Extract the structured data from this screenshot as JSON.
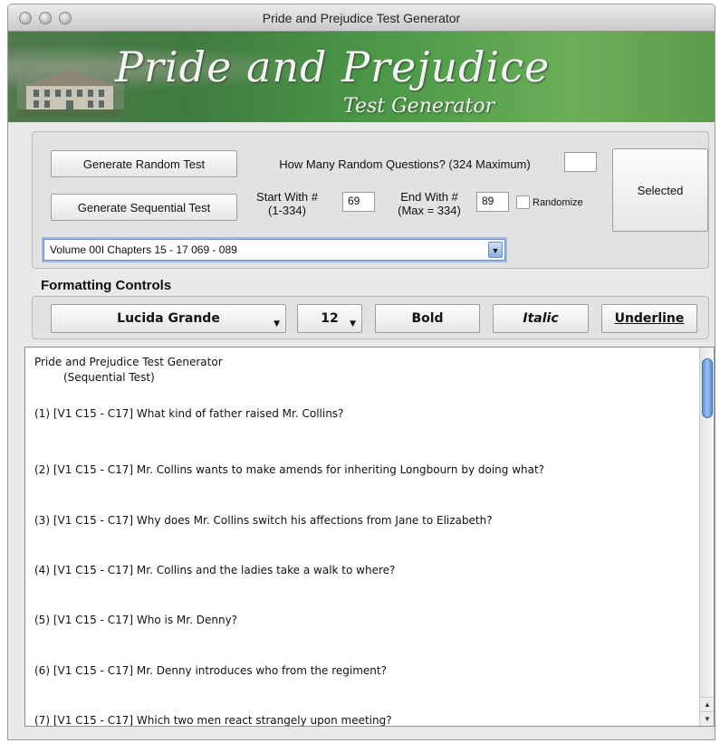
{
  "window": {
    "title": "Pride and Prejudice Test Generator"
  },
  "banner": {
    "title": "Pride and Prejudice",
    "subtitle": "Test Generator"
  },
  "generator": {
    "random_button": "Generate Random Test",
    "random_label": "How Many Random Questions? (324 Maximum)",
    "random_value": "",
    "sequential_button": "Generate Sequential Test",
    "start_label_1": "Start With #",
    "start_label_2": "(1-334)",
    "start_value": "69",
    "end_label_1": "End With #",
    "end_label_2": "(Max = 334)",
    "end_value": "89",
    "randomize_label": "Randomize",
    "selected_button": "Selected",
    "volume_select": "Volume 00I   Chapters 15 - 17  069 - 089"
  },
  "formatting": {
    "heading": "Formatting Controls",
    "font": "Lucida Grande",
    "size": "12",
    "bold": "Bold",
    "italic": "Italic",
    "underline": "Underline"
  },
  "document": {
    "title": "Pride and Prejudice Test Generator",
    "subtitle": "(Sequential Test)",
    "questions": [
      "(1)  [V1 C15 - C17] What kind of father raised Mr. Collins?",
      "(2)  [V1 C15 - C17] Mr. Collins wants to make amends for inheriting Longbourn by doing what?",
      "(3)  [V1 C15 - C17] Why does Mr. Collins switch his affections from Jane to Elizabeth?",
      "(4)  [V1 C15 - C17] Mr. Collins and the ladies take a walk to where?",
      "(5)  [V1 C15 - C17] Who is Mr. Denny?",
      "(6)  [V1 C15 - C17] Mr. Denny introduces who from the regiment?",
      "(7)  [V1 C15 - C17] Which two men react strangely upon meeting?"
    ]
  }
}
